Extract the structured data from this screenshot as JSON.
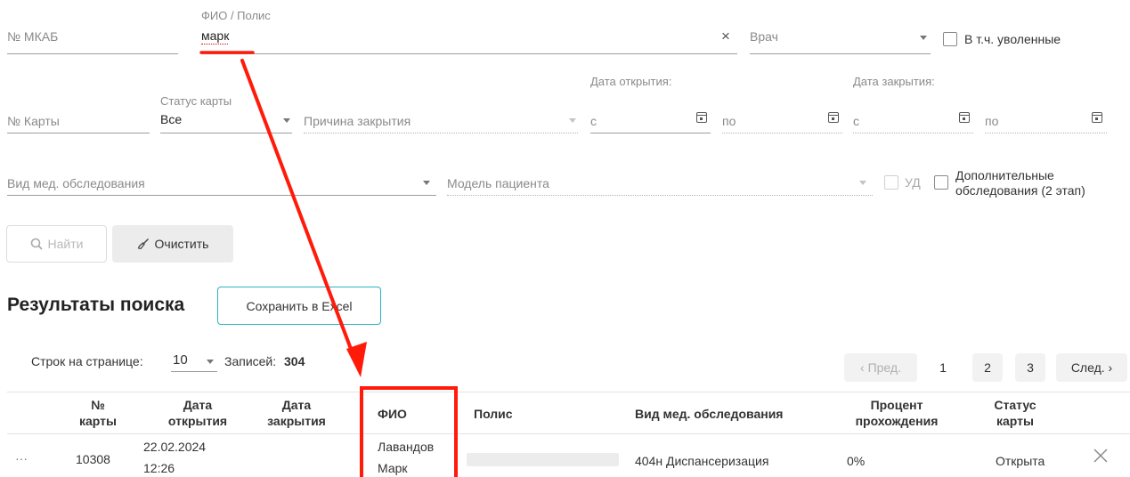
{
  "filters": {
    "mkab_label": "№ МКАБ",
    "fio_label": "ФИО / Полис",
    "fio_value": "марк",
    "clear_symbol": "×",
    "doctor_label": "Врач",
    "fired_label": "В т.ч. уволенные",
    "open_date_label": "Дата открытия:",
    "close_date_label": "Дата закрытия:",
    "card_label": "№ Карты",
    "status_label": "Статус карты",
    "status_value": "Все",
    "close_reason_label": "Причина закрытия",
    "from_label": "с",
    "to_label": "по",
    "exam_type_label": "Вид мед. обследования",
    "patient_model_label": "Модель пациента",
    "ud_label": "УД",
    "extra_label_line1": "Дополнительные",
    "extra_label_line2": "обследования (2 этап)"
  },
  "actions": {
    "search_label": "Найти",
    "clear_label": "Очистить",
    "search_icon": "search-icon",
    "clear_icon": "broom-icon"
  },
  "results": {
    "title": "Результаты поиска",
    "excel_label": "Сохранить в Excel",
    "rows_per_page_label": "Строк на странице:",
    "rows_per_page_value": "10",
    "records_label": "Записей:",
    "records_count": "304"
  },
  "pagination": {
    "prev": "‹ Пред.",
    "pages": [
      "1",
      "2",
      "3"
    ],
    "next": "След. ›"
  },
  "table": {
    "columns": {
      "card_no": [
        "№",
        "карты"
      ],
      "open_date": [
        "Дата",
        "открытия"
      ],
      "close_date": [
        "Дата",
        "закрытия"
      ],
      "fio": [
        "ФИО"
      ],
      "policy": [
        "Полис"
      ],
      "exam_type": [
        "Вид мед. обследования"
      ],
      "percent": [
        "Процент",
        "прохождения"
      ],
      "status": [
        "Статус",
        "карты"
      ]
    },
    "rows": [
      {
        "menu": "···",
        "card_no": "10308",
        "open_date": "22.02.2024",
        "open_time": "12:26",
        "close_date": "",
        "fio_line1": "Лавандов",
        "fio_line2": "Марк",
        "policy": "",
        "exam_type": "404н Диспансеризация",
        "percent": "0%",
        "status": "Открыта",
        "delete_icon": "close-icon"
      }
    ]
  },
  "colors": {
    "annotation": "#ff1a0a",
    "excel_border": "#2bb3c0",
    "muted": "#8a8a8a"
  }
}
